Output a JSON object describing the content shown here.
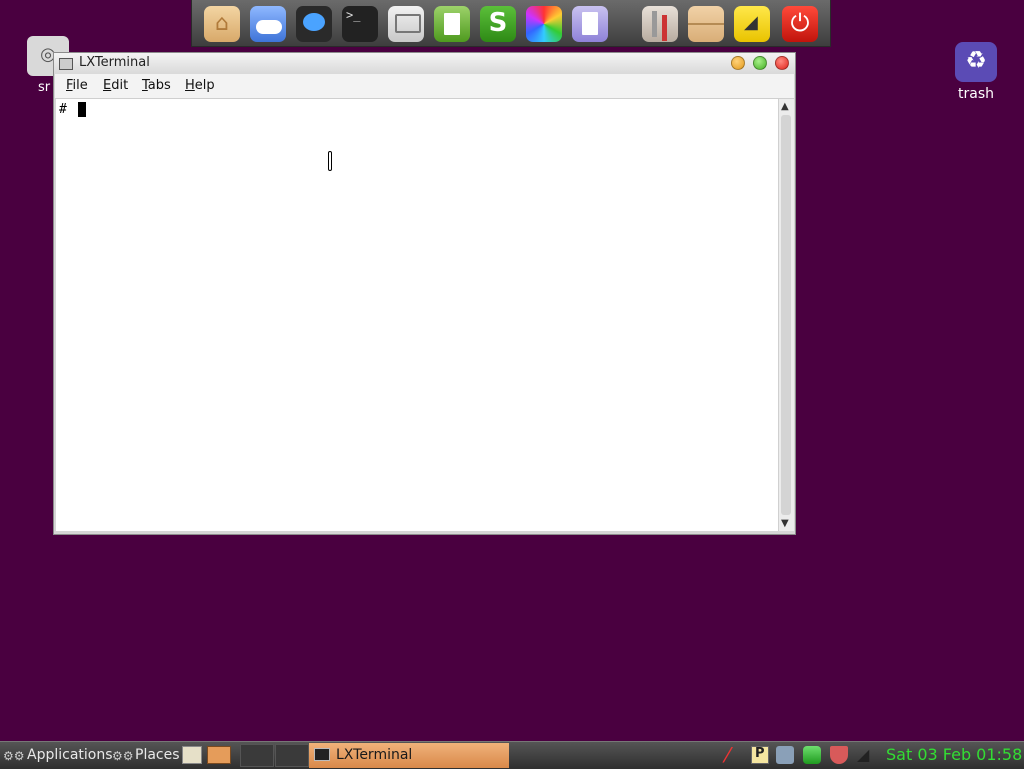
{
  "dock": {
    "icons": [
      "home-folder-icon",
      "cloud-icon",
      "chat-icon",
      "terminal-icon",
      "monitor-icon",
      "writer-icon",
      "spreadsheet-icon",
      "color-picker-icon",
      "text-document-icon",
      "tools-icon",
      "drawer-icon",
      "ruler-icon",
      "power-icon"
    ]
  },
  "desktop": {
    "cd_label": "sr",
    "trash_label": "trash"
  },
  "window": {
    "title": "LXTerminal",
    "menu": [
      "File",
      "Edit",
      "Tabs",
      "Help"
    ],
    "prompt": "#"
  },
  "panel": {
    "applications": "Applications",
    "places": "Places",
    "task_label": "LXTerminal",
    "clock": "Sat 03 Feb 01:58"
  },
  "colors": {
    "desktop_bg": "#4a0040",
    "clock_green": "#33dd33",
    "active_task": "#e59c5a"
  }
}
